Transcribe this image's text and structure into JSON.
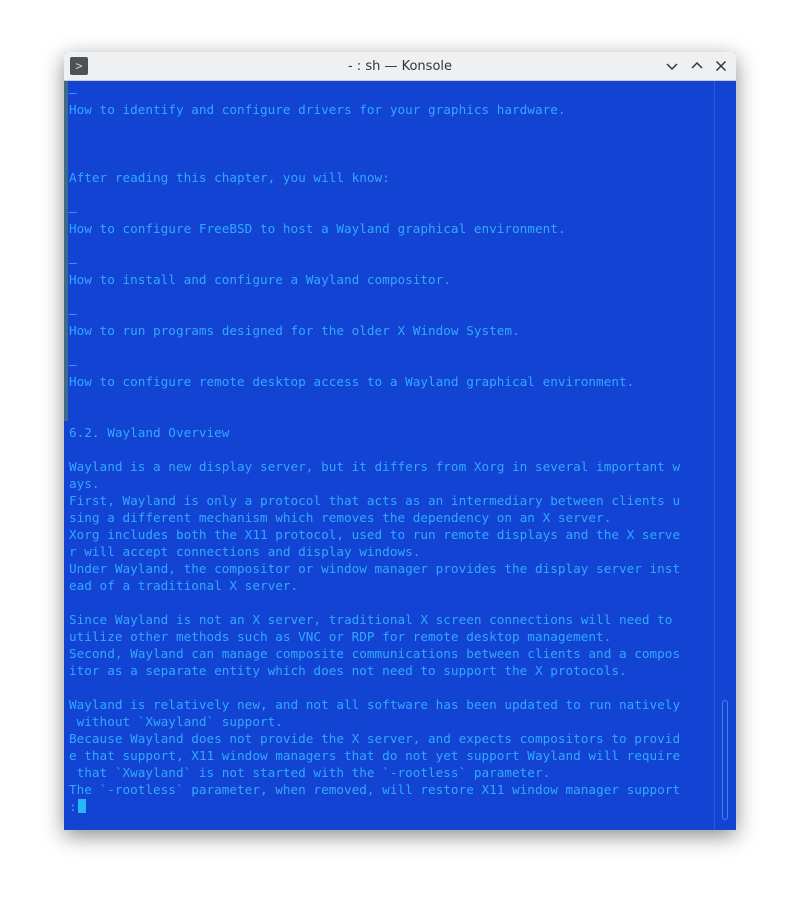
{
  "window": {
    "title": "- : sh — Konsole",
    "app_icon": "terminal-icon",
    "buttons": [
      "minimize",
      "maximize",
      "close"
    ]
  },
  "terminal": {
    "lines": [
      "–",
      "How to identify and configure drivers for your graphics hardware.",
      "",
      "",
      "",
      "After reading this chapter, you will know:",
      "",
      "–",
      "How to configure FreeBSD to host a Wayland graphical environment.",
      "",
      "–",
      "How to install and configure a Wayland compositor.",
      "",
      "–",
      "How to run programs designed for the older X Window System.",
      "",
      "–",
      "How to configure remote desktop access to a Wayland graphical environment.",
      "",
      "",
      "6.2. Wayland Overview",
      "",
      "Wayland is a new display server, but it differs from Xorg in several important w",
      "ays.",
      "First, Wayland is only a protocol that acts as an intermediary between clients u",
      "sing a different mechanism which removes the dependency on an X server.",
      "Xorg includes both the X11 protocol, used to run remote displays and the X serve",
      "r will accept connections and display windows.",
      "Under Wayland, the compositor or window manager provides the display server inst",
      "ead of a traditional X server.",
      "",
      "Since Wayland is not an X server, traditional X screen connections will need to",
      "utilize other methods such as VNC or RDP for remote desktop management.",
      "Second, Wayland can manage composite communications between clients and a compos",
      "itor as a separate entity which does not need to support the X protocols.",
      "",
      "Wayland is relatively new, and not all software has been updated to run natively",
      " without `Xwayland` support.",
      "Because Wayland does not provide the X server, and expects compositors to provid",
      "e that support, X11 window managers that do not yet support Wayland will require",
      " that `Xwayland` is not started with the `-rootless` parameter.",
      "The `-rootless` parameter, when removed, will restore X11 window manager support",
      ":"
    ]
  },
  "colors": {
    "terminal_bg": "#1243d2",
    "terminal_fg": "#31a8ff",
    "titlebar_bg": "#eff0f1"
  }
}
